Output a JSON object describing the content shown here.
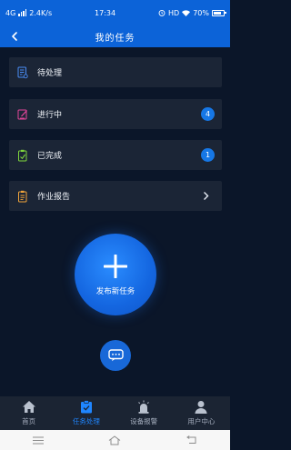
{
  "status_bar": {
    "network": "4G",
    "speed": "2.4K/s",
    "time": "17:34",
    "hd": "HD",
    "battery": "70%"
  },
  "header": {
    "title": "我的任务"
  },
  "menu": [
    {
      "label": "待处理",
      "icon": "clipboard-icon"
    },
    {
      "label": "进行中",
      "icon": "edit-icon",
      "badge": "4"
    },
    {
      "label": "已完成",
      "icon": "check-clipboard-icon",
      "badge": "1"
    },
    {
      "label": "作业报告",
      "icon": "report-icon"
    }
  ],
  "fab": {
    "label": "发布新任务"
  },
  "tabs": [
    {
      "label": "首页",
      "icon": "home-icon"
    },
    {
      "label": "任务处理",
      "icon": "task-icon",
      "active": true
    },
    {
      "label": "设备报警",
      "icon": "alarm-icon"
    },
    {
      "label": "用户中心",
      "icon": "user-icon"
    }
  ],
  "colors": {
    "accent": "#0c63d8",
    "badge": "#1677e6",
    "background": "#0b1629",
    "card": "#1b2536",
    "active_tab": "#1f86ff"
  }
}
